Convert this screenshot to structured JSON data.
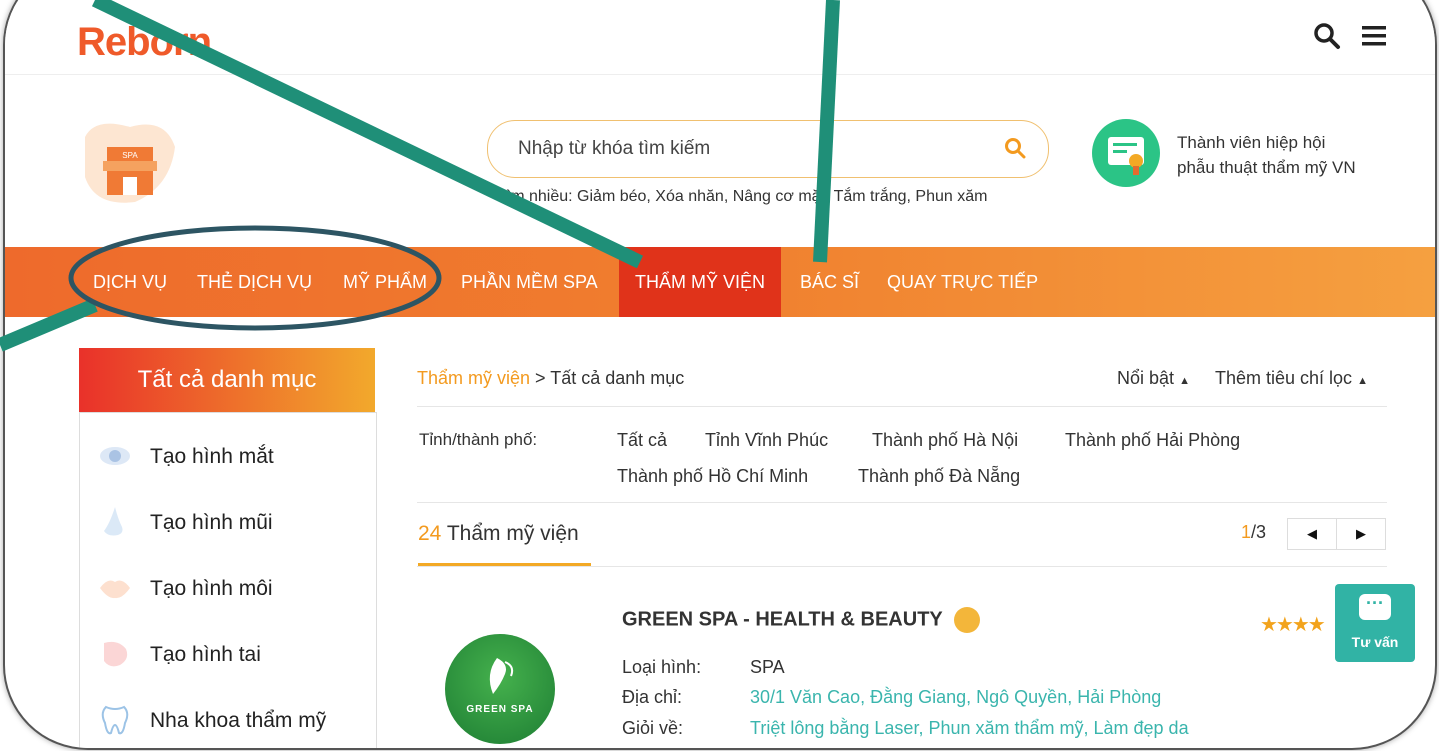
{
  "header": {
    "logo_text": "Reborn",
    "icons": [
      "search-icon",
      "menu-icon"
    ]
  },
  "search": {
    "placeholder": "Nhập từ khóa tìm kiếm",
    "popular_prefix": "Tìm nhiều:",
    "popular_terms": "Giảm béo, Xóa nhăn, Nâng cơ mặt, Tắm trắng, Phun xăm"
  },
  "member": {
    "line1": "Thành viên hiệp hội",
    "line2": "phẫu thuật thẩm mỹ VN"
  },
  "nav": {
    "items": [
      {
        "label": "DỊCH VỤ"
      },
      {
        "label": "THẺ DỊCH VỤ"
      },
      {
        "label": "MỸ PHẨM"
      },
      {
        "label": "PHẦN MỀM SPA"
      },
      {
        "label": "THẨM MỸ VIỆN",
        "active": true
      },
      {
        "label": "BÁC SĨ"
      },
      {
        "label": "QUAY TRỰC TIẾP"
      }
    ]
  },
  "sidebar": {
    "title": "Tất cả danh mục",
    "items": [
      {
        "label": "Tạo hình mắt",
        "icon": "eye-icon"
      },
      {
        "label": "Tạo hình mũi",
        "icon": "nose-icon"
      },
      {
        "label": "Tạo hình môi",
        "icon": "lips-icon"
      },
      {
        "label": "Tạo hình tai",
        "icon": "ear-icon"
      },
      {
        "label": "Nha khoa thẩm mỹ",
        "icon": "tooth-icon"
      }
    ]
  },
  "breadcrumb": {
    "link": "Thẩm mỹ viện",
    "separator": " > ",
    "current": "Tất cả danh mục"
  },
  "sort": {
    "featured": "Nổi bật",
    "more_filters": "Thêm tiêu chí lọc"
  },
  "filter": {
    "label": "Tỉnh/thành phố:",
    "cities": [
      "Tất cả",
      "Tỉnh Vĩnh Phúc",
      "Thành phố Hà Nội",
      "Thành phố Hải Phòng",
      "Thành phố Hồ Chí Minh",
      "Thành phố Đà Nẵng"
    ]
  },
  "results": {
    "count": "24",
    "label": "Thẩm mỹ viện",
    "page_current": "1",
    "page_total": "/3"
  },
  "listing": {
    "name": "GREEN SPA - HEALTH & BEAUTY",
    "logo_text": "GREEN SPA",
    "type_label": "Loại hình:",
    "type_value": "SPA",
    "address_label": "Địa chỉ:",
    "address_value": "30/1 Văn Cao, Đằng Giang, Ngô Quyền, Hải Phòng",
    "specialty_label": "Giỏi về:",
    "specialty_value": "Triệt lông bằng Laser,  Phun xăm thẩm mỹ,  Làm đẹp da",
    "rating_stars": 4
  },
  "chat": {
    "label": "Tư vấn"
  },
  "colors": {
    "accent_orange": "#f39a1f",
    "nav_active": "#e0331a",
    "teal": "#31b3a5",
    "annotation_line": "#1f8f78",
    "annotation_ellipse": "#2d5563"
  }
}
